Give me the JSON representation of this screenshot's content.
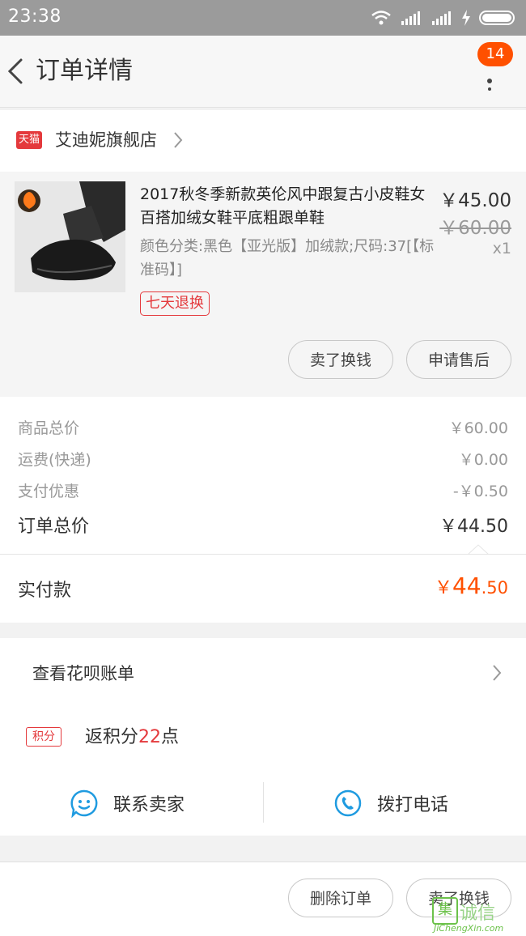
{
  "status_bar": {
    "time": "23:38"
  },
  "header": {
    "title": "订单详情",
    "badge_count": "14"
  },
  "shop": {
    "logo_text": "天猫",
    "name": "艾迪妮旗舰店"
  },
  "product": {
    "title": "2017秋冬季新款英伦风中跟复古小皮鞋女百搭加绒女鞋平底粗跟单鞋",
    "spec": "颜色分类:黑色【亚光版】加绒款;尺码:37[【标准码】]",
    "tag": "七天退换",
    "price_now": "￥45.00",
    "price_old": "￥60.00",
    "qty": "x1",
    "buttons": {
      "sell": "卖了换钱",
      "after_sale": "申请售后"
    }
  },
  "summary": {
    "rows": [
      {
        "label": "商品总价",
        "value": "￥60.00"
      },
      {
        "label": "运费(快递)",
        "value": "￥0.00"
      },
      {
        "label": "支付优惠",
        "value": "-￥0.50"
      }
    ],
    "total": {
      "label": "订单总价",
      "value": "￥44.50"
    }
  },
  "paid": {
    "label": "实付款",
    "currency": "￥",
    "int": "44",
    "dec": ".50"
  },
  "huabei": {
    "label": "查看花呗账单"
  },
  "points": {
    "badge": "积分",
    "prefix": "返积分",
    "number": "22",
    "suffix": "点"
  },
  "actions": {
    "contact": "联系卖家",
    "call": "拨打电话"
  },
  "bottom": {
    "delete": "删除订单",
    "sell": "卖了换钱"
  },
  "watermark": {
    "mark": "集",
    "cn": "诚信",
    "url": "JiChengXin.com"
  },
  "colors": {
    "accent": "#ff5000",
    "tmall_red": "#e4393c",
    "link_blue": "#1f9be0"
  },
  "icons": [
    "back-arrow-icon",
    "more-icon",
    "chevron-right-icon",
    "smiley-chat-icon",
    "phone-icon",
    "wifi-icon",
    "signal-icon",
    "battery-icon"
  ]
}
